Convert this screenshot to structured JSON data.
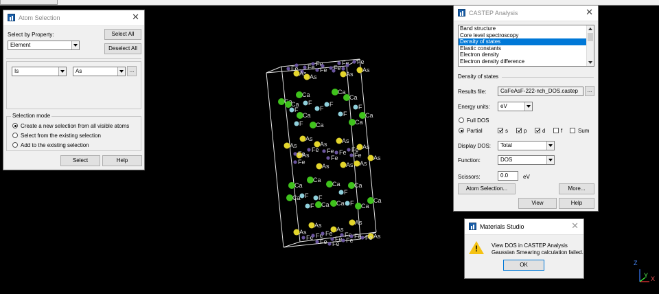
{
  "atom_selection": {
    "title": "Atom Selection",
    "select_by_label": "Select by Property:",
    "property_value": "Element",
    "select_all": "Select All",
    "deselect_all": "Deselect All",
    "operator_value": "Is",
    "element_value": "As",
    "ellipsis": "...",
    "mode_title": "Selection mode",
    "mode_options": [
      "Create a new selection from all visible atoms",
      "Select from the existing selection",
      "Add to the existing selection"
    ],
    "select_button": "Select",
    "help_button": "Help"
  },
  "castep": {
    "title": "CASTEP Analysis",
    "list_items": [
      "Band structure",
      "Core level spectroscopy",
      "Density of states",
      "Elastic constants",
      "Electron density",
      "Electron density difference"
    ],
    "selected_index": 2,
    "section_title": "Density of states",
    "results_file_label": "Results file:",
    "results_file_value": "CaFeAsF-222-nch_DOS.castep",
    "ellipsis": "...",
    "energy_units_label": "Energy units:",
    "energy_units_value": "eV",
    "full_dos": "Full DOS",
    "partial": "Partial",
    "checks": [
      {
        "label": "s",
        "checked": true
      },
      {
        "label": "p",
        "checked": true
      },
      {
        "label": "d",
        "checked": true
      },
      {
        "label": "f",
        "checked": false
      },
      {
        "label": "Sum",
        "checked": false
      }
    ],
    "display_dos_label": "Display DOS:",
    "display_dos_value": "Total",
    "function_label": "Function:",
    "function_value": "DOS",
    "scissors_label": "Scissors:",
    "scissors_value": "0.0",
    "scissors_unit": "eV",
    "atom_selection_button": "Atom Selection...",
    "more_button": "More...",
    "view_button": "View",
    "help_button": "Help"
  },
  "message": {
    "title": "Materials Studio",
    "line1": "View DOS in CASTEP Analysis",
    "line2": "Gaussian Smearing calculation failed.",
    "ok": "OK"
  },
  "atom_labels": {
    "fe": "Fe",
    "as": "As",
    "ca": "Ca",
    "f": "F"
  },
  "axis": {
    "z": "Z",
    "x": "X",
    "y": "Y"
  },
  "colors": {
    "ca": "#3fc21c",
    "as": "#e3d52c",
    "f": "#8fd0dc",
    "fe": "#6a55a0",
    "cell": "#e6e6e6",
    "warn": "#f5c211",
    "select": "#0078d7"
  }
}
